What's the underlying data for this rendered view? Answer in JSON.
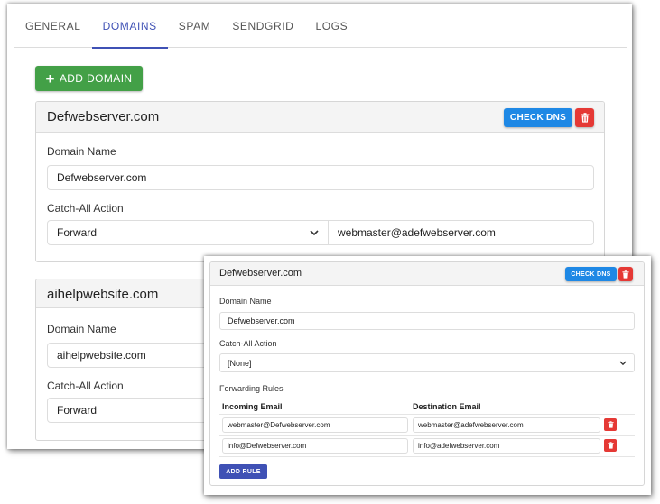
{
  "tabs": [
    "GENERAL",
    "DOMAINS",
    "SPAM",
    "SENDGRID",
    "LOGS"
  ],
  "active_tab": "DOMAINS",
  "add_domain_label": "ADD DOMAIN",
  "icons": {
    "add": "plus-icon",
    "delete": "trash-icon",
    "dropdown": "chevron-down-icon"
  },
  "colors": {
    "tab_active": "#3f51b5",
    "add_domain": "#43a047",
    "check_dns": "#1e88e5",
    "delete": "#e53935",
    "add_rule": "#3f51b5"
  },
  "domains": [
    {
      "title": "Defwebserver.com",
      "check_dns_label": "CHECK DNS",
      "domain_name_label": "Domain Name",
      "domain_name_value": "Defwebserver.com",
      "catch_all_label": "Catch-All Action",
      "catch_all_value": "Forward",
      "forward_to": "webmaster@adefwebserver.com"
    },
    {
      "title": "aihelpwebsite.com",
      "domain_name_label": "Domain Name",
      "domain_name_value": "aihelpwebsite.com",
      "catch_all_label": "Catch-All Action",
      "catch_all_value": "Forward"
    }
  ],
  "detail": {
    "title": "Defwebserver.com",
    "check_dns_label": "CHECK DNS",
    "domain_name_label": "Domain Name",
    "domain_name_value": "Defwebserver.com",
    "catch_all_label": "Catch-All Action",
    "catch_all_value": "[None]",
    "forwarding_rules_label": "Forwarding Rules",
    "col_incoming": "Incoming Email",
    "col_destination": "Destination Email",
    "rules": [
      {
        "incoming": "webmaster@Defwebserver.com",
        "destination": "webmaster@adefwebserver.com"
      },
      {
        "incoming": "info@Defwebserver.com",
        "destination": "info@adefwebserver.com"
      }
    ],
    "add_rule_label": "ADD RULE"
  }
}
